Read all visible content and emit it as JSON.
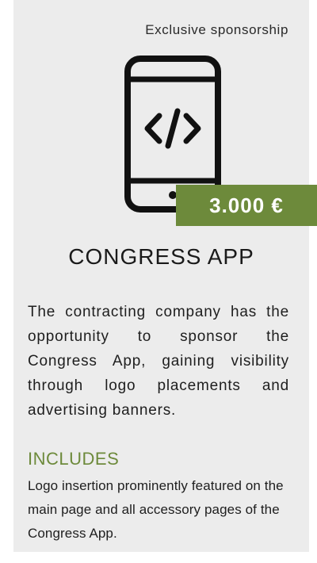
{
  "card": {
    "tag": "Exclusive sponsorship",
    "icon": "smartphone-code-icon",
    "price": "3.000 €",
    "title": "CONGRESS APP",
    "description": "The contracting company has the opportunity to sponsor the Congress App, gaining visibility through logo placements and advertising banners.",
    "includes_heading": "INCLUDES",
    "includes_text": "Logo insertion prominently featured on the main page and all accessory pages of the Congress App."
  },
  "colors": {
    "accent": "#6d8a3b",
    "card_background": "#ececec",
    "text": "#1e1e1e"
  }
}
